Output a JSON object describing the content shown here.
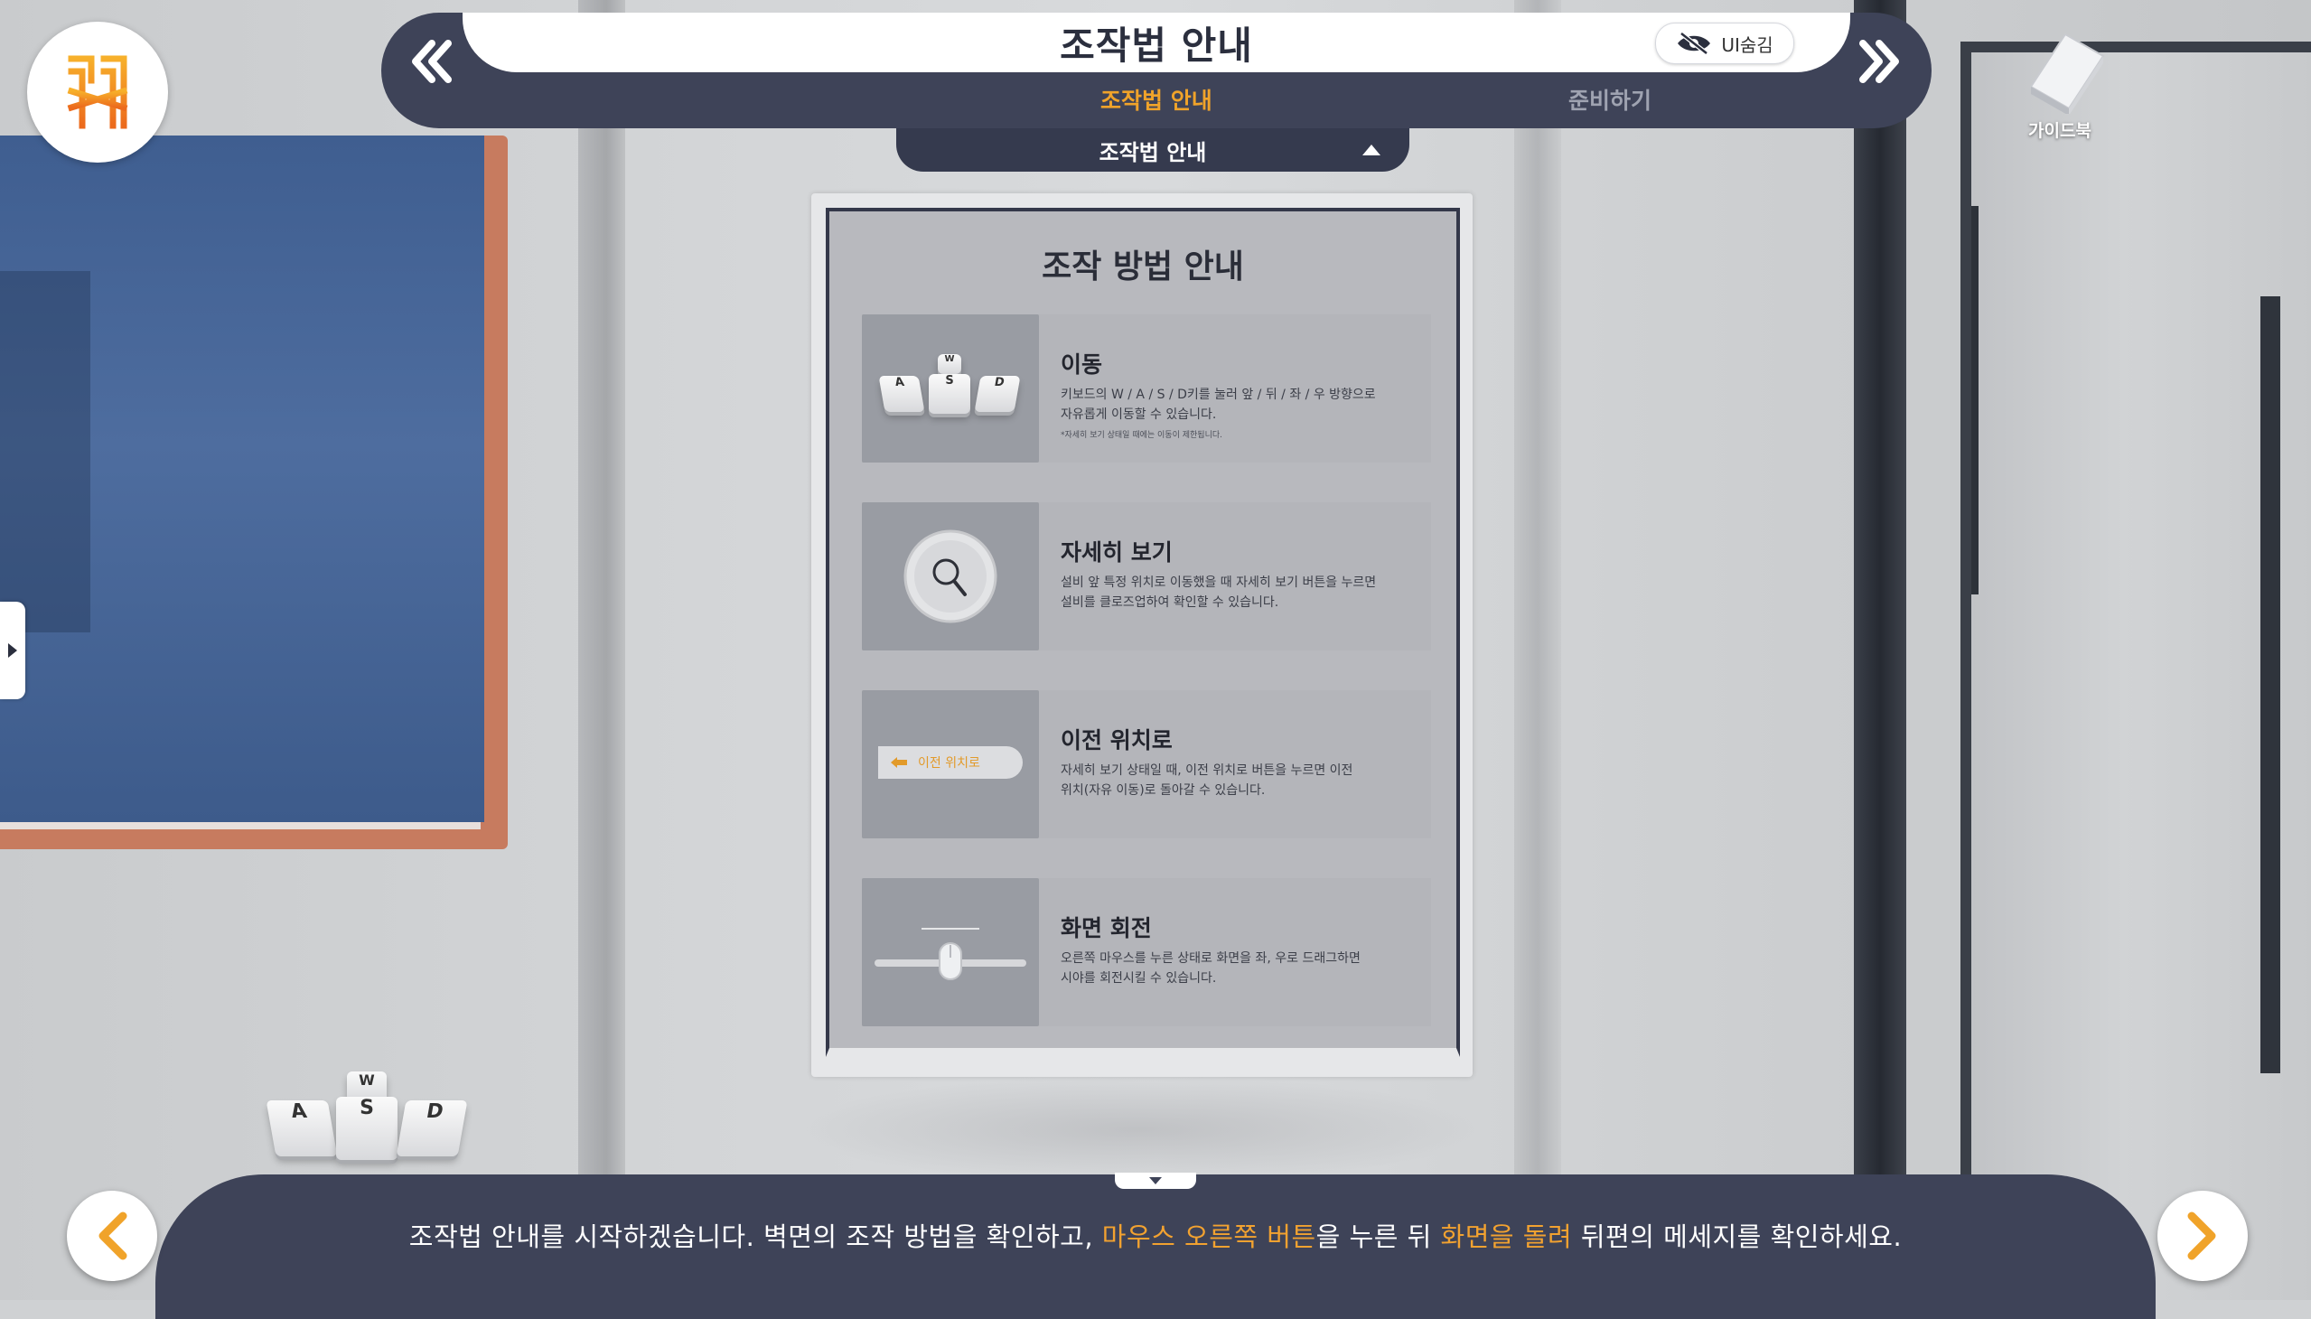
{
  "header": {
    "title": "조작법 안내",
    "ui_hide_label": "UI숨김",
    "tabs": [
      {
        "label": "조작법 안내",
        "active": true
      },
      {
        "label": "준비하기",
        "active": false
      }
    ],
    "dropdown_label": "조작법 안내",
    "accent_color": "#f0a32a"
  },
  "guidebook": {
    "label": "가이드북"
  },
  "poster": {
    "title": "조작 방법 안내",
    "items": [
      {
        "icon": "wasd-keys-icon",
        "title": "이동",
        "desc_line1": "키보드의 W / A / S / D키를 눌러 앞 / 뒤 / 좌 / 우 방향으로",
        "desc_line2": "자유롭게 이동할 수 있습니다.",
        "note": "*자세히 보기 상태일 때에는 이동이 제한됩니다.",
        "key_w": "W",
        "key_a": "A",
        "key_s": "S",
        "key_d": "D"
      },
      {
        "icon": "magnifier-icon",
        "title": "자세히 보기",
        "desc_line1": "설비 앞 특정 위치로 이동했을 때 자세히 보기 버튼을 누르면",
        "desc_line2": "설비를 클로즈업하여 확인할 수 있습니다."
      },
      {
        "icon": "back-arrow-icon",
        "title": "이전 위치로",
        "desc_line1": "자세히 보기 상태일 때, 이전 위치로 버튼을 누르면 이전",
        "desc_line2": "위치(자유 이동)로 돌아갈 수 있습니다.",
        "button_label": "이전 위치로"
      },
      {
        "icon": "mouse-drag-icon",
        "title": "화면 회전",
        "desc_line1": "오른쪽 마우스를 누른 상태로 화면을 좌, 우로 드래그하면",
        "desc_line2": "시야를 회전시킬 수 있습니다."
      }
    ]
  },
  "scene_keys": {
    "w": "W",
    "a": "A",
    "s": "S",
    "d": "D"
  },
  "dialog": {
    "part1": "조작법 안내를 시작하겠습니다. 벽면의 조작 방법을 확인하고, ",
    "highlight1": "마우스 오른쪽 버튼",
    "part2": "을 누른 뒤 ",
    "highlight2": "화면을 돌려",
    "part3": " 뒤편의 메세지를 확인하세요.",
    "highlight_color": "#f2a230"
  }
}
